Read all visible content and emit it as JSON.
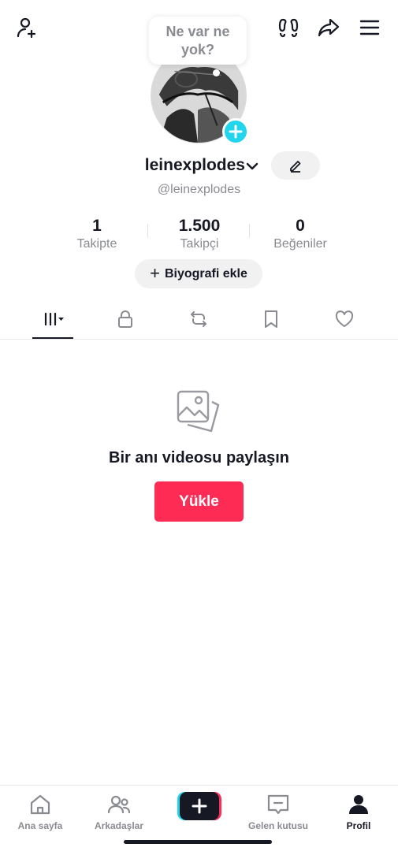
{
  "profile": {
    "bubble_text": "Ne var ne yok?",
    "username": "leinexplodes",
    "handle": "@leinexplodes"
  },
  "stats": [
    {
      "value": "1",
      "label": "Takipte"
    },
    {
      "value": "1.500",
      "label": "Takipçi"
    },
    {
      "value": "0",
      "label": "Beğeniler"
    }
  ],
  "bio_button": {
    "label": "Biyografi ekle"
  },
  "tabs": [
    {
      "icon": "videos-grid-icon",
      "active": true
    },
    {
      "icon": "lock-icon"
    },
    {
      "icon": "repost-icon"
    },
    {
      "icon": "bookmark-icon"
    },
    {
      "icon": "heart-icon"
    }
  ],
  "empty_state": {
    "title": "Bir anı videosu paylaşın",
    "upload_label": "Yükle"
  },
  "bottom_nav": [
    {
      "label": "Ana sayfa",
      "icon": "home-icon"
    },
    {
      "label": "Arkadaşlar",
      "icon": "friends-icon"
    },
    {
      "label": "",
      "icon": "create-plus-icon"
    },
    {
      "label": "Gelen kutusu",
      "icon": "inbox-icon"
    },
    {
      "label": "Profil",
      "icon": "profile-icon",
      "active": true
    }
  ],
  "colors": {
    "accent": "#fe2c55",
    "plus_badge": "#20d5ec",
    "text_primary": "#161823",
    "text_secondary": "#8a8b91"
  }
}
